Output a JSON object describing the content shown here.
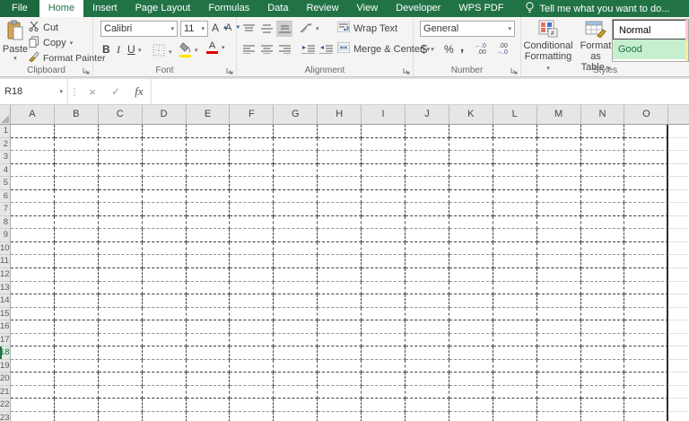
{
  "colors": {
    "excel_green": "#217346",
    "good_bg": "#C6EFCE",
    "good_text": "#006100",
    "fill_color_swatch": "#FFE100",
    "font_color_swatch": "#E00000",
    "gallery_edge_top": "#FFC7CE",
    "gallery_edge_bottom": "#FFEB9C"
  },
  "tab_bar": {
    "tabs": [
      {
        "label": "File",
        "style": "file"
      },
      {
        "label": "Home",
        "style": "selected"
      },
      {
        "label": "Insert"
      },
      {
        "label": "Page Layout"
      },
      {
        "label": "Formulas"
      },
      {
        "label": "Data"
      },
      {
        "label": "Review"
      },
      {
        "label": "View"
      },
      {
        "label": "Developer"
      },
      {
        "label": "WPS PDF"
      }
    ],
    "tell_me": "Tell me what you want to do..."
  },
  "ribbon": {
    "clipboard": {
      "label": "Clipboard",
      "paste": "Paste",
      "cut": "Cut",
      "copy": "Copy",
      "format_painter": "Format Painter"
    },
    "font": {
      "label": "Font",
      "font_name": "Calibri",
      "font_size": "11",
      "grow_font": "A",
      "shrink_font": "A",
      "bold": "B",
      "italic": "I",
      "underline": "U",
      "font_color_letter": "A"
    },
    "alignment": {
      "label": "Alignment",
      "wrap_text": "Wrap Text",
      "merge_center": "Merge & Center"
    },
    "number": {
      "label": "Number",
      "format": "General",
      "currency": "$",
      "percent": "%",
      "comma": ",",
      "inc_top": "←.0",
      "inc_bottom": ".00",
      "dec_top": ".00",
      "dec_bottom": "→.0"
    },
    "styles": {
      "label": "Styles",
      "cf_line1": "Conditional",
      "cf_line2": "Formatting",
      "fat_line1": "Format as",
      "fat_line2": "Table",
      "gallery": [
        {
          "name": "Normal",
          "bg": "#FFFFFF",
          "color": "#000000",
          "bordered": true
        },
        {
          "name": "Good",
          "bg": "#C6EFCE",
          "color": "#1E7145",
          "bordered": false
        }
      ]
    }
  },
  "formula_bar": {
    "name_box": "R18",
    "cancel": "×",
    "enter": "✓",
    "fx": "fx",
    "formula": ""
  },
  "sheet": {
    "columns": [
      "A",
      "B",
      "C",
      "D",
      "E",
      "F",
      "G",
      "H",
      "I",
      "J",
      "K",
      "L",
      "M",
      "N",
      "O"
    ],
    "rows": [
      1,
      2,
      3,
      4,
      5,
      6,
      7,
      8,
      9,
      10,
      11,
      12,
      13,
      14,
      15,
      16,
      17,
      18,
      19,
      20,
      21,
      22,
      23
    ],
    "active_row": 18,
    "active_cell": "R18"
  }
}
